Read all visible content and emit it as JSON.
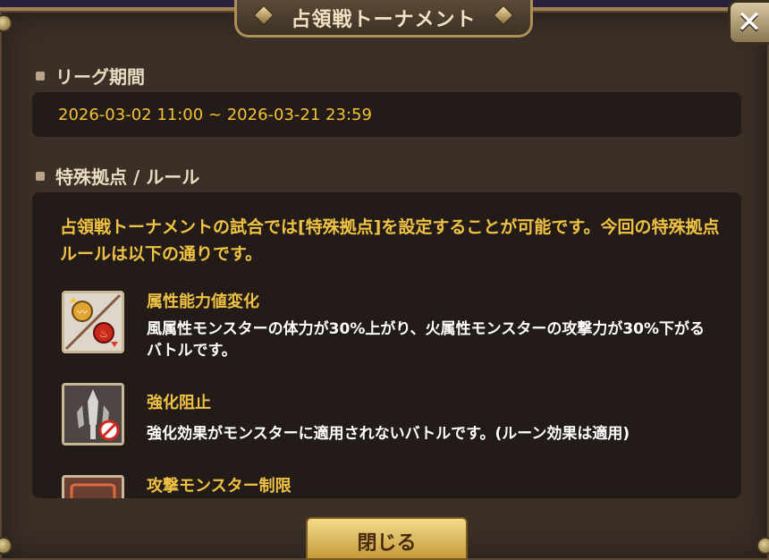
{
  "dialog": {
    "title": "占領戦トーナメント",
    "close_icon": "close-icon"
  },
  "league": {
    "heading": "リーグ期間",
    "period": "2026-03-02 11:00 ~ 2026-03-21 23:59"
  },
  "special": {
    "heading": "特殊拠点 / ルール",
    "intro": "占領戦トーナメントの試合では[特殊拠点]を設定することが可能です。今回の特殊拠点ルールは以下の通りです。",
    "rules": [
      {
        "icon": "attribute-change-icon",
        "title": "属性能力値変化",
        "desc": "風属性モンスターの体力が30%上がり、火属性モンスターの攻撃力が30%下がるバトルです。"
      },
      {
        "icon": "buff-block-icon",
        "title": "強化阻止",
        "desc": "強化効果がモンスターに適用されないバトルです。(ルーン効果は適用)"
      },
      {
        "icon": "attack-limit-icon",
        "title": "攻撃モンスター制限",
        "desc": ""
      }
    ]
  },
  "footer": {
    "close_label": "閉じる"
  },
  "colors": {
    "accent": "#f0c244",
    "panel": "#3b2f27",
    "box": "#231b17"
  }
}
